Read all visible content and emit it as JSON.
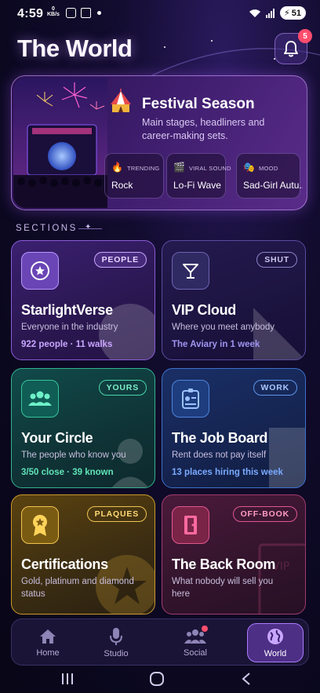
{
  "status": {
    "time": "4:59",
    "kbs_value": "0",
    "kbs_unit": "KB/s",
    "battery": "51"
  },
  "header": {
    "title": "The World",
    "notifications_count": "5"
  },
  "festival": {
    "title": "Festival Season",
    "subtitle": "Main stages, headliners and career-making sets.",
    "chips": [
      {
        "label": "TRENDING",
        "value": "Rock",
        "icon": "fire-icon"
      },
      {
        "label": "VIRAL SOUND",
        "value": "Lo-Fi Wave",
        "icon": "clapperboard-icon"
      },
      {
        "label": "MOOD",
        "value": "Sad-Girl Autu...",
        "icon": "theater-masks-icon"
      }
    ]
  },
  "sections_label": "SECTIONS",
  "cards": [
    {
      "badge": "PEOPLE",
      "title": "StarlightVerse",
      "subtitle": "Everyone in the industry",
      "stat": "922 people · 11 walks"
    },
    {
      "badge": "SHUT",
      "title": "VIP Cloud",
      "subtitle": "Where you meet anybody",
      "stat": "The Aviary in 1 week"
    },
    {
      "badge": "YOURS",
      "title": "Your Circle",
      "subtitle": "The people who know you",
      "stat": "3/50 close · 39 known"
    },
    {
      "badge": "WORK",
      "title": "The Job Board",
      "subtitle": "Rent does not pay itself",
      "stat": "13 places hiring this week"
    },
    {
      "badge": "PLAQUES",
      "title": "Certifications",
      "subtitle": "Gold, platinum and diamond status",
      "stat": ""
    },
    {
      "badge": "OFF-BOOK",
      "title": "The Back Room",
      "subtitle": "What nobody will sell you here",
      "stat": ""
    }
  ],
  "nav": [
    {
      "label": "Home",
      "icon": "home-icon"
    },
    {
      "label": "Studio",
      "icon": "microphone-icon"
    },
    {
      "label": "Social",
      "icon": "people-icon"
    },
    {
      "label": "World",
      "icon": "globe-icon",
      "active": true
    }
  ],
  "colors": {
    "accent": "#a97cff",
    "badge_red": "#ff4d6d"
  }
}
